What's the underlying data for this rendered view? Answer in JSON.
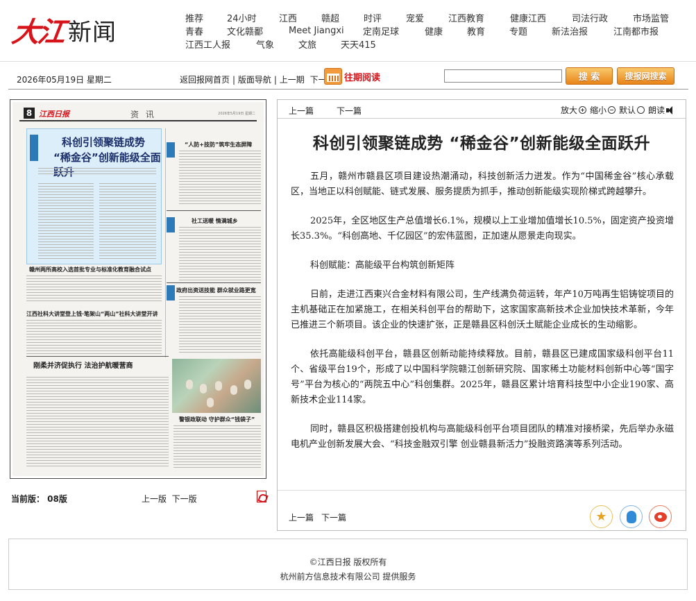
{
  "logo": {
    "red_text": "大江",
    "black_text": "新闻"
  },
  "nav": {
    "row1": [
      "推荐",
      "24小时",
      "江西",
      "赣超",
      "时评",
      "宠爱",
      "江西教育",
      "健康江西",
      "司法行政",
      "市场监管"
    ],
    "row2": [
      "青春",
      "文化赣鄱",
      "Meet Jiangxi",
      "定南足球",
      "健康",
      "教育",
      "专题",
      "新法治报",
      "江南都市报"
    ],
    "row3": [
      "江西工人报",
      "气象",
      "文旅",
      "天天415"
    ]
  },
  "toolbar": {
    "date": "2026年05月19日 星期二",
    "home": "返回报网首页",
    "layout": "版面导航",
    "prev_issue": "上一期",
    "next_issue": "下一期",
    "archive": "往期阅读",
    "search_placeholder": "",
    "search_btn": "搜 索",
    "site_search_btn": "搜报网搜索"
  },
  "thumbnail": {
    "page_num": "8",
    "brand": "江西日报",
    "section": "资 讯",
    "date": "2026年5月19日 星期二",
    "headline1": "科创引领聚链成势",
    "headline2": "“稀金谷”创新能级全面跃升",
    "sub1": "赣州两所高校入选首批专业与标准化教育融合试点",
    "sub2": "江西社科大讲堂登上钱·笔架山“两山”社科大讲堂开讲",
    "sub3": "刚柔并济促执行  法治护航暖营商",
    "right1": "“人防+技防”筑牢生态屏障",
    "right2": "社工送暖  情满城乡",
    "right3": "政府出资送技能  群众就业路更宽",
    "photo_caption": "警银政联动  守护群众“钱袋子”"
  },
  "thumb_footer": {
    "current": "当前版：  08版",
    "prev": "上一版",
    "next": "下一版",
    "pdf": "PDF"
  },
  "article": {
    "prev": "上一篇",
    "next": "下一篇",
    "zoom_in": "放大",
    "zoom_out": "缩小",
    "default": "默认",
    "read": "朗读",
    "title": "科创引领聚链成势  “稀金谷”创新能级全面跃升",
    "paragraphs": [
      "五月，赣州市赣县区项目建设热潮涌动，科技创新活力迸发。作为“中国稀金谷”核心承载区，当地正以科创赋能、链式发展、服务提质为抓手，推动创新能级实现阶梯式跨越攀升。",
      "2025年，全区地区生产总值增长6.1%，规模以上工业增加值增长10.5%，固定资产投资增长35.3%。“科创高地、千亿园区”的宏伟蓝图，正加速从愿景走向现实。",
      "科创赋能：高能级平台构筑创新矩阵",
      "日前，走进江西東兴合金材料有限公司，生产线满负荷运转，年产10万吨再生铝铸锭项目的主机基础正在加紧施工，在相关科创平台的帮助下，这家国家高新技术企业加快技术革新，今年已推进三个新项目。该企业的快速扩张，正是赣县区科创沃土赋能企业成长的生动缩影。",
      "依托高能级科创平台，赣县区创新动能持续释放。目前，赣县区已建成国家级科创平台11个、省级平台19个，形成了以中国科学院赣江创新研究院、国家稀土功能材料创新中心等“国字号”平台为核心的“两院五中心”科创集群。2025年，赣县区累计培育科技型中小企业190家、高新技术企业114家。",
      "同时，赣县区积极搭建创投机构与高能级科创平台项目团队的精准对接桥梁，先后举办永磁电机产业创新发展大会、“科技金融双引擎 创业赣县新活力”投融资路演等系列活动。"
    ],
    "bottom_prev": "上一篇",
    "bottom_next": "下一篇"
  },
  "footer": {
    "line1": "©江西日报 版权所有",
    "line2": "杭州前方信息技术有限公司   提供服务"
  }
}
